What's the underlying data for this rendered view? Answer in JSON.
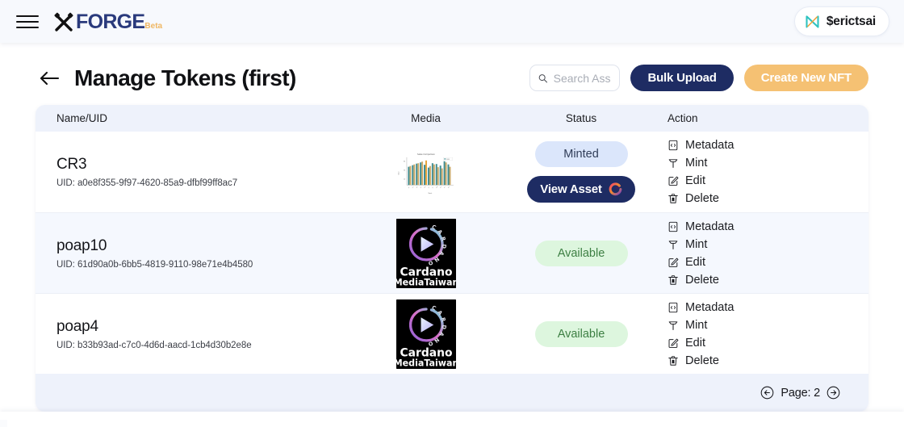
{
  "header": {
    "menu_icon": "hamburger-icon",
    "brand_name": "FORGE",
    "brand_badge": "Beta",
    "brand_logo_icon": "forge-hammers-icon",
    "user_name": "$erictsai",
    "user_wallet_icon": "nami-wallet-icon"
  },
  "page": {
    "back_icon": "arrow-left-icon",
    "title": "Manage Tokens (first)",
    "search": {
      "icon": "search-icon",
      "placeholder": "Search Asset",
      "value": ""
    },
    "buttons": {
      "bulk_upload": "Bulk Upload",
      "create_nft": "Create New NFT"
    }
  },
  "table": {
    "columns": [
      "Name/UID",
      "Media",
      "Status",
      "Action"
    ],
    "uid_prefix": "UID: ",
    "rows": [
      {
        "name": "CR3",
        "uid": "UID: a0e8f355-9f97-4620-85a9-dfbf99ff8ac7",
        "media_type": "bar-chart-thumbnail",
        "status": "Minted",
        "status_kind": "minted",
        "view_asset_label": "View Asset",
        "view_asset_icon": "cardano-c-icon",
        "actions": [
          "Metadata",
          "Mint",
          "Edit",
          "Delete"
        ]
      },
      {
        "name": "poap10",
        "uid": "UID: 61d90a0b-6bb5-4819-9110-98e71e4b4580",
        "media_type": "cardano-media-taiwan-thumbnail",
        "status": "Available",
        "status_kind": "available",
        "actions": [
          "Metadata",
          "Mint",
          "Edit",
          "Delete"
        ]
      },
      {
        "name": "poap4",
        "uid": "UID: b33b93ad-c7c0-4d6d-aacd-1cb4d30b2e8e",
        "media_type": "cardano-media-taiwan-thumbnail",
        "status": "Available",
        "status_kind": "available",
        "actions": [
          "Metadata",
          "Mint",
          "Edit",
          "Delete"
        ]
      }
    ],
    "media_logo": {
      "line1": "Cardano",
      "line2": "MediaTaiwan",
      "ring_text": "CARDANO"
    },
    "action_icons": {
      "Metadata": "file-code-icon",
      "Mint": "hammer-icon",
      "Edit": "pencil-square-icon",
      "Delete": "trash-icon"
    },
    "pagination": {
      "prev_icon": "circle-arrow-left-icon",
      "next_icon": "circle-arrow-right-icon",
      "label": "Page: 2"
    }
  },
  "colors": {
    "navy": "#1e2c63",
    "gold": "#f5c173",
    "card_bg": "#eef2fb",
    "minted_bg": "#dbe6fb",
    "available_bg": "#ddf6de",
    "available_text": "#3d7f43"
  }
}
